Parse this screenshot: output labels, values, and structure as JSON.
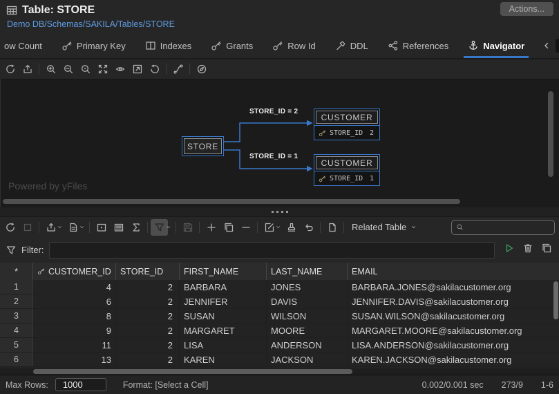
{
  "header": {
    "title": "Table: STORE",
    "breadcrumb": "Demo DB/Schemas/SAKILA/Tables/STORE",
    "actions_button": "Actions..."
  },
  "tabs": {
    "accent_color": "#3977c9",
    "items": [
      {
        "label": "ow Count",
        "icon": "",
        "selected": false
      },
      {
        "label": "Primary Key",
        "icon": "key-icon",
        "selected": false
      },
      {
        "label": "Indexes",
        "icon": "split-table-icon",
        "selected": false
      },
      {
        "label": "Grants",
        "icon": "key-icon",
        "selected": false
      },
      {
        "label": "Row Id",
        "icon": "key-icon",
        "selected": false
      },
      {
        "label": "DDL",
        "icon": "hammer-icon",
        "selected": false
      },
      {
        "label": "References",
        "icon": "nodes-icon",
        "selected": false
      },
      {
        "label": "Navigator",
        "icon": "anchor-icon",
        "selected": true
      }
    ]
  },
  "diagram_toolbar": {
    "icons": [
      "refresh-icon",
      "export-diagram-icon",
      "zoom-in-icon",
      "zoom-out-icon",
      "zoom-selection-icon",
      "fit-content-icon",
      "view-selection-icon",
      "open-in-window-icon",
      "reset-zoom-icon",
      "route-edges-icon",
      "compass-icon"
    ]
  },
  "diagram": {
    "watermark": "Powered by yFiles",
    "edge_color": "#3977c9",
    "store_node": {
      "title": "STORE"
    },
    "customer_top": {
      "title": "CUSTOMER",
      "attr_name": "STORE_ID",
      "attr_value": "2"
    },
    "customer_bottom": {
      "title": "CUSTOMER",
      "attr_name": "STORE_ID",
      "attr_value": "1"
    },
    "edges": [
      {
        "label": "STORE_ID = 2"
      },
      {
        "label": "STORE_ID = 1"
      }
    ]
  },
  "data_toolbar": {
    "icons": [
      "refresh-icon",
      "stop-icon",
      "export-icon",
      "report-icon",
      "record-view-icon",
      "text-view-icon",
      "sigma-icon",
      "filter-icon",
      "save-icon",
      "add-row-icon",
      "duplicate-row-icon",
      "delete-row-icon",
      "edit-icon",
      "stamp-icon",
      "undo-icon",
      "new-document-icon",
      "search-icon"
    ],
    "related_table_label": "Related Table",
    "search_value": ""
  },
  "filter_bar": {
    "label": "Filter:",
    "value": ""
  },
  "grid": {
    "columns": [
      "*",
      "CUSTOMER_ID",
      "STORE_ID",
      "FIRST_NAME",
      "LAST_NAME",
      "EMAIL"
    ],
    "rows": [
      {
        "num": "1",
        "customer_id": "4",
        "store_id": "2",
        "first_name": "BARBARA",
        "last_name": "JONES",
        "email": "BARBARA.JONES@sakilacustomer.org"
      },
      {
        "num": "2",
        "customer_id": "6",
        "store_id": "2",
        "first_name": "JENNIFER",
        "last_name": "DAVIS",
        "email": "JENNIFER.DAVIS@sakilacustomer.org"
      },
      {
        "num": "3",
        "customer_id": "8",
        "store_id": "2",
        "first_name": "SUSAN",
        "last_name": "WILSON",
        "email": "SUSAN.WILSON@sakilacustomer.org"
      },
      {
        "num": "4",
        "customer_id": "9",
        "store_id": "2",
        "first_name": "MARGARET",
        "last_name": "MOORE",
        "email": "MARGARET.MOORE@sakilacustomer.org"
      },
      {
        "num": "5",
        "customer_id": "11",
        "store_id": "2",
        "first_name": "LISA",
        "last_name": "ANDERSON",
        "email": "LISA.ANDERSON@sakilacustomer.org"
      },
      {
        "num": "6",
        "customer_id": "13",
        "store_id": "2",
        "first_name": "KAREN",
        "last_name": "JACKSON",
        "email": "KAREN.JACKSON@sakilacustomer.org"
      }
    ]
  },
  "status_bar": {
    "max_rows_label": "Max Rows:",
    "max_rows_value": "1000",
    "format_label": "Format: [Select a Cell]",
    "exec_time": "0.002/0.001 sec",
    "fetch_stats": "273/9",
    "row_range": "1-6"
  }
}
